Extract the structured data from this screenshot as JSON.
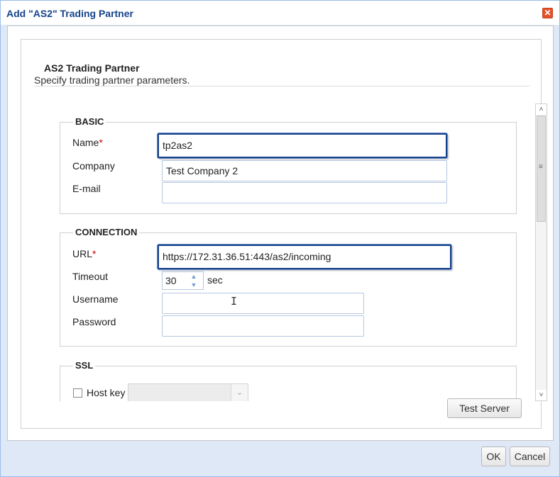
{
  "window": {
    "title": "Add \"AS2\" Trading Partner",
    "close_symbol": "✕"
  },
  "panel": {
    "title": "AS2 Trading Partner",
    "subtitle": "Specify trading partner parameters."
  },
  "basic": {
    "legend": "BASIC",
    "name_label": "Name",
    "required_mark": "*",
    "name_value": "tp2as2",
    "company_label": "Company",
    "company_value": "Test Company 2",
    "email_label": "E-mail",
    "email_value": ""
  },
  "connection": {
    "legend": "CONNECTION",
    "url_label": "URL",
    "required_mark": "*",
    "url_value": "https://172.31.36.51:443/as2/incoming",
    "timeout_label": "Timeout",
    "timeout_value": "30",
    "timeout_unit": "sec",
    "username_label": "Username",
    "username_value": "",
    "password_label": "Password",
    "password_value": ""
  },
  "ssl": {
    "legend": "SSL",
    "host_key_label": "Host key",
    "host_key_checked": false,
    "host_key_value": ""
  },
  "buttons": {
    "test_server": "Test Server",
    "ok": "OK",
    "cancel": "Cancel"
  },
  "colors": {
    "title_blue": "#15428b",
    "focus_border": "#15428b",
    "required_red": "#cc0000",
    "close_red": "#e3512c"
  },
  "icons": {
    "close": "close-icon",
    "spin_up": "chevron-up-icon",
    "spin_down": "chevron-down-icon",
    "combo": "chevron-down-icon"
  }
}
